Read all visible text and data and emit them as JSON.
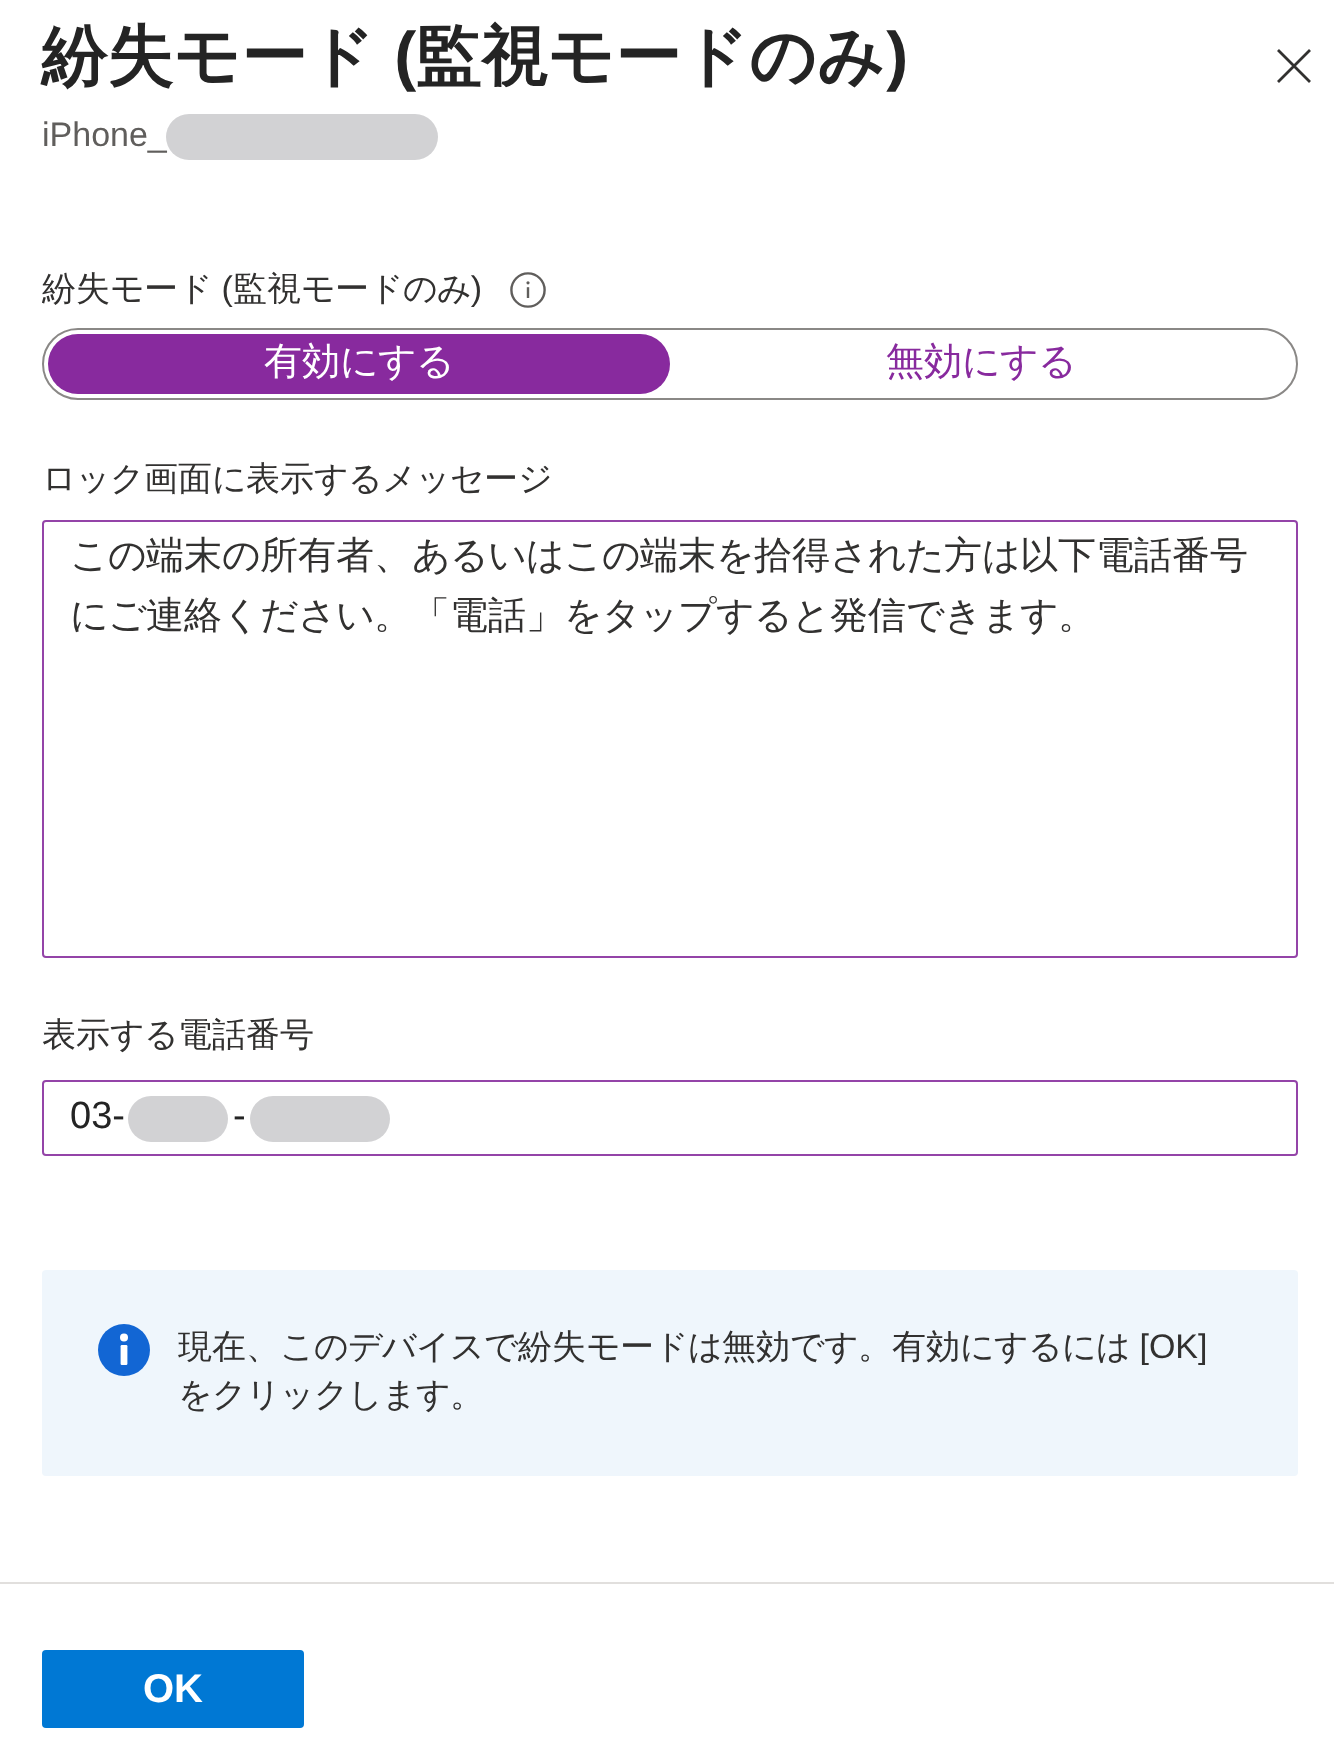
{
  "panel": {
    "title": "紛失モード (監視モードのみ)",
    "subtitle": [
      {
        "kind": "text",
        "text": "iPhone_"
      },
      {
        "kind": "redacted"
      }
    ]
  },
  "lost_mode": {
    "label": "紛失モード (監視モードのみ)",
    "options": [
      {
        "label": "有効にする",
        "selected": true
      },
      {
        "label": "無効にする",
        "selected": false
      }
    ]
  },
  "message": {
    "label": "ロック画面に表示するメッセージ",
    "value": "この端末の所有者、あるいはこの端末を拾得された方は以下電話番号にご連絡ください。「電話」をタップすると発信できます。"
  },
  "phone": {
    "label": "表示する電話番号",
    "value": [
      {
        "kind": "text",
        "text": "03-"
      },
      {
        "kind": "redacted"
      },
      {
        "kind": "text",
        "text": "-"
      },
      {
        "kind": "redacted"
      }
    ]
  },
  "info_banner": {
    "text": "現在、このデバイスで紛失モードは無効です。有効にするには [OK] をクリックします。"
  },
  "buttons": [
    {
      "label": "OK",
      "kind": "primary"
    }
  ]
}
